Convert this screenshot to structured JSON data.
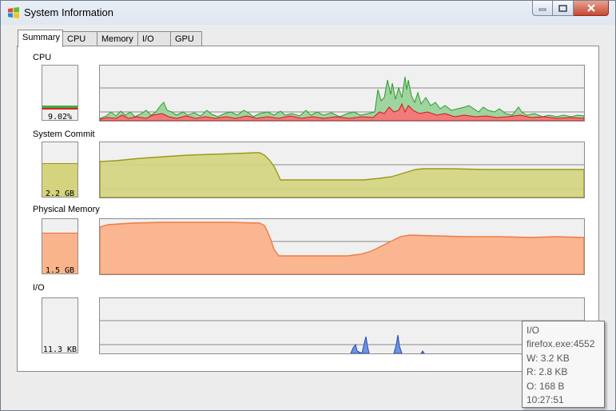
{
  "window": {
    "title": "System Information"
  },
  "tabs": [
    {
      "label": "Summary",
      "active": true
    },
    {
      "label": "CPU",
      "active": false
    },
    {
      "label": "Memory",
      "active": false
    },
    {
      "label": "I/O",
      "active": false
    },
    {
      "label": "GPU",
      "active": false
    }
  ],
  "colors": {
    "cpu_total": "#3fae3f",
    "cpu_kernel": "#e02020",
    "commit": "#cccc55",
    "physical_memory": "#f99a6b",
    "io": "#3258c8"
  },
  "sections": {
    "cpu": {
      "label": "CPU",
      "value": "9.02%"
    },
    "commit": {
      "label": "System Commit",
      "value": "2.2 GB"
    },
    "physical": {
      "label": "Physical Memory",
      "value": "1.5 GB"
    },
    "io": {
      "label": "I/O",
      "value": "11.3  KB"
    }
  },
  "tooltip": {
    "lines": [
      "I/O",
      "firefox.exe:4552",
      "W: 3.2  KB",
      "R: 2.8  KB",
      "O: 168 B",
      "10:27:51"
    ]
  }
}
